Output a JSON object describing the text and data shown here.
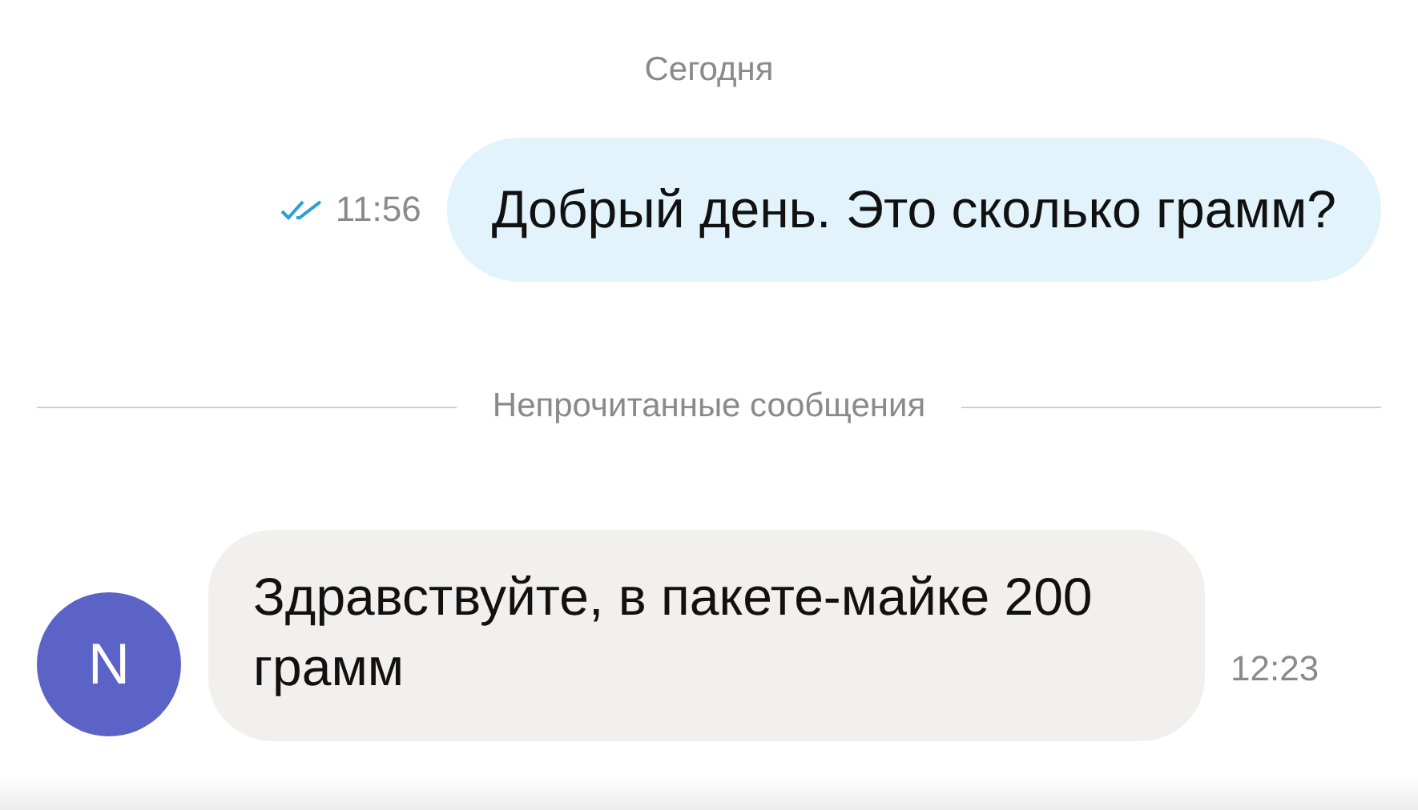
{
  "date_label": "Сегодня",
  "messages": [
    {
      "kind": "outgoing",
      "text": "Добрый день. Это сколько грамм?",
      "time": "11:56",
      "read": true
    },
    {
      "kind": "divider",
      "text": "Непрочитанные сообщения"
    },
    {
      "kind": "incoming",
      "avatar": "N",
      "text": "Здравствуйте, в пакете-майке 200 грамм",
      "time": "12:23"
    }
  ]
}
